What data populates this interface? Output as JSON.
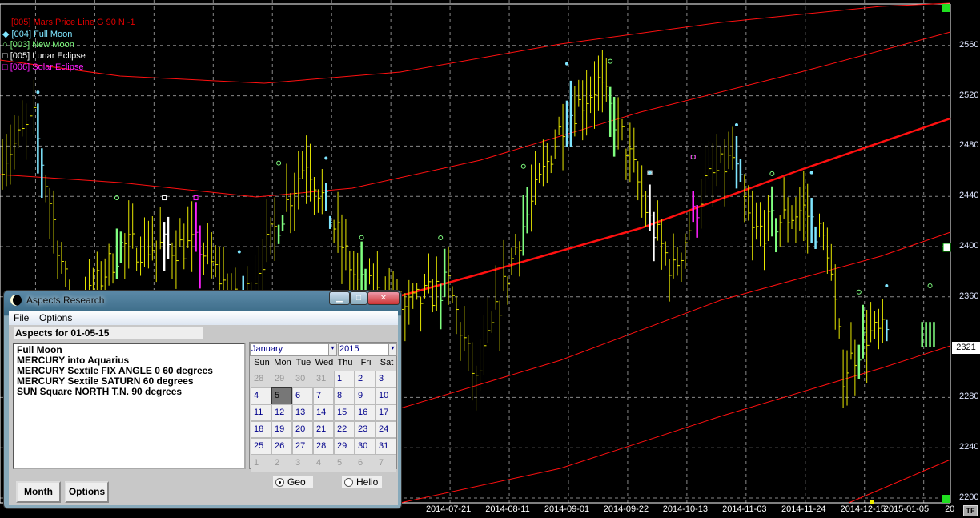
{
  "legend": [
    {
      "marker": "",
      "label": "[005] Mars Price Line G 90 N -1",
      "color": "#e00000"
    },
    {
      "marker": "◆",
      "label": "[004] Full Moon",
      "color": "#7fe6ff"
    },
    {
      "marker": "○",
      "label": "[003] New Moon",
      "color": "#80ff80"
    },
    {
      "marker": "□",
      "label": "[005] Lunar Eclipse",
      "color": "#ffffff"
    },
    {
      "marker": "□",
      "label": "[006] Solar Eclipse",
      "color": "#ff20ff"
    }
  ],
  "y_axis": [
    "2560",
    "2520",
    "2480",
    "2440",
    "2400",
    "2360",
    "2280",
    "2240",
    "2200"
  ],
  "y_values": [
    2560,
    2520,
    2480,
    2440,
    2400,
    2360,
    2280,
    2240,
    2200
  ],
  "current_price": "2321",
  "x_axis": [
    "2014-07-21",
    "2014-08-11",
    "2014-09-01",
    "2014-09-22",
    "2014-10-13",
    "2014-11-03",
    "2014-11-24",
    "2014-12-15",
    "2015-01-05",
    "20"
  ],
  "x_bar_index": [
    113,
    128,
    143,
    158,
    173,
    188,
    203,
    218,
    229,
    240
  ],
  "tf_label": "TF",
  "price_anchors": [
    [
      0,
      2470
    ],
    [
      8,
      2500
    ],
    [
      18,
      2340
    ],
    [
      30,
      2400
    ],
    [
      50,
      2400
    ],
    [
      60,
      2350
    ],
    [
      77,
      2470
    ],
    [
      90,
      2370
    ],
    [
      102,
      2350
    ],
    [
      113,
      2370
    ],
    [
      120,
      2290
    ],
    [
      130,
      2400
    ],
    [
      142,
      2500
    ],
    [
      151,
      2530
    ],
    [
      158,
      2480
    ],
    [
      164,
      2420
    ],
    [
      170,
      2380
    ],
    [
      178,
      2450
    ],
    [
      185,
      2470
    ],
    [
      190,
      2410
    ],
    [
      203,
      2430
    ],
    [
      209,
      2400
    ],
    [
      213,
      2300
    ],
    [
      219,
      2330
    ],
    [
      224,
      2330
    ]
  ],
  "events": [
    [
      9,
      "full"
    ],
    [
      60,
      "full"
    ],
    [
      82,
      "full"
    ],
    [
      143,
      "full"
    ],
    [
      164,
      "full"
    ],
    [
      186,
      "full"
    ],
    [
      205,
      "full"
    ],
    [
      224,
      "full"
    ],
    [
      29,
      "new"
    ],
    [
      70,
      "new"
    ],
    [
      91,
      "new"
    ],
    [
      111,
      "new"
    ],
    [
      132,
      "new"
    ],
    [
      154,
      "new"
    ],
    [
      175,
      "new"
    ],
    [
      195,
      "new"
    ],
    [
      217,
      "new"
    ],
    [
      235,
      "new"
    ],
    [
      41,
      "lunar"
    ],
    [
      164,
      "lunar"
    ],
    [
      49,
      "solar"
    ],
    [
      175,
      "solar"
    ]
  ],
  "colors": {
    "bar": "#e8e800",
    "full": "#7fe6ff",
    "new": "#80ff80",
    "lunar": "#ffffff",
    "solar": "#ff20ff",
    "line": "#ff1010",
    "grid": "#888888"
  },
  "dialog": {
    "title": "Aspects Research",
    "menu": [
      "File",
      "Options"
    ],
    "aspects_for": "Aspects for 01-05-15",
    "aspects": [
      "Full Moon",
      "MERCURY into Aquarius",
      "MERCURY Sextile FIX ANGLE  0  60 degrees",
      "MERCURY Sextile SATURN  60 degrees",
      "SUN Square NORTH T.N.  90 degrees"
    ],
    "month": "January",
    "year": "2015",
    "day_names": [
      "Sun",
      "Mon",
      "Tue",
      "Wed",
      "Thu",
      "Fri",
      "Sat"
    ],
    "days": [
      [
        "28",
        "29",
        "30",
        "31",
        "1",
        "2",
        "3"
      ],
      [
        "4",
        "5",
        "6",
        "7",
        "8",
        "9",
        "10"
      ],
      [
        "11",
        "12",
        "13",
        "14",
        "15",
        "16",
        "17"
      ],
      [
        "18",
        "19",
        "20",
        "21",
        "22",
        "23",
        "24"
      ],
      [
        "25",
        "26",
        "27",
        "28",
        "29",
        "30",
        "31"
      ],
      [
        "1",
        "2",
        "3",
        "4",
        "5",
        "6",
        "7"
      ]
    ],
    "selected_day": "5",
    "buttons": [
      "Month",
      "Options"
    ],
    "radios": [
      {
        "label": "Geo",
        "checked": true
      },
      {
        "label": "Helio",
        "checked": false
      }
    ]
  }
}
